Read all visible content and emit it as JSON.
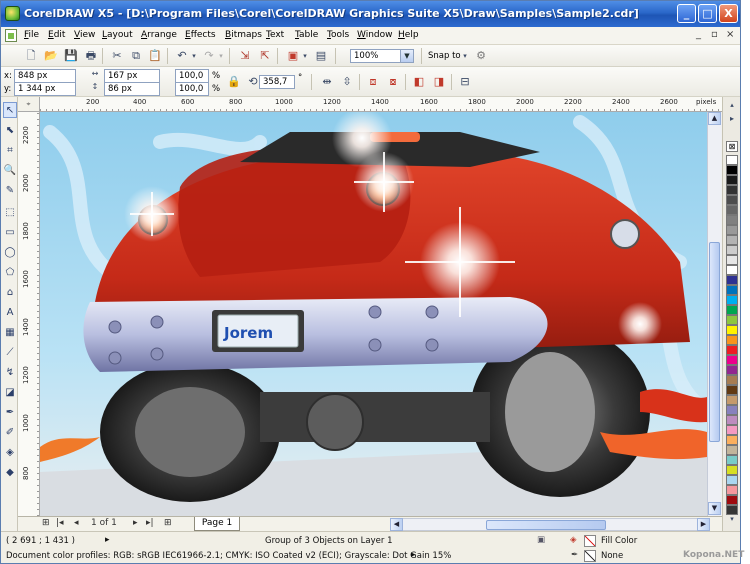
{
  "window": {
    "title": "CorelDRAW X5 - [D:\\Program Files\\Corel\\CorelDRAW Graphics Suite X5\\Draw\\Samples\\Sample2.cdr]",
    "minimize_glyph": "_",
    "maximize_glyph": "□",
    "close_glyph": "X"
  },
  "menubar": {
    "items": [
      "File",
      "Edit",
      "View",
      "Layout",
      "Arrange",
      "Effects",
      "Bitmaps",
      "Text",
      "Table",
      "Tools",
      "Window",
      "Help"
    ],
    "doc_controls": [
      "_",
      "▫",
      "×"
    ]
  },
  "standard_toolbar": {
    "zoom_value": "100%",
    "snap_label": "Snap to"
  },
  "property_bar": {
    "x_label": "x:",
    "x_value": "848 px",
    "y_label": "y:",
    "y_value": "1 344 px",
    "width_value": "167 px",
    "height_value": "86 px",
    "scale_x": "100,0",
    "scale_y": "100,0",
    "percent": "%",
    "rotation_value": "358,7",
    "degree": "°"
  },
  "rulers": {
    "corner": "⌖",
    "top_ticks": [
      "200",
      "400",
      "600",
      "800",
      "1000",
      "1200",
      "1400",
      "1600",
      "1800",
      "2000",
      "2200",
      "2400",
      "2600",
      "pixels"
    ],
    "left_ticks": [
      "2200",
      "2000",
      "1800",
      "1600",
      "1400",
      "1200",
      "1000",
      "800"
    ]
  },
  "document_nav": {
    "page_count": "1 of 1",
    "page_tab": "Page 1"
  },
  "status": {
    "coords": "( 2 691 ; 1 431 )",
    "selection": "Group of 3 Objects on Layer 1",
    "fill_label": "Fill Color",
    "outline_label": "None",
    "color_profiles": "Document color profiles: RGB: sRGB IEC61966-2.1; CMYK: ISO Coated v2 (ECI); Grayscale: Dot Gain 15%"
  },
  "artwork": {
    "license_plate_text": "Jorem"
  },
  "palette_colors": [
    "#ffffff",
    "#000000",
    "#1a1a1a",
    "#333333",
    "#4d4d4d",
    "#666666",
    "#808080",
    "#999999",
    "#b3b3b3",
    "#cccccc",
    "#e6e6e6",
    "#ffffff",
    "#2e3192",
    "#0072bc",
    "#00aeef",
    "#00a651",
    "#8dc63f",
    "#fff200",
    "#f7941d",
    "#ed1c24",
    "#ec008c",
    "#92278f",
    "#a67c52",
    "#603913",
    "#c49a6c",
    "#8781bd",
    "#bd8cbf",
    "#f49ac1",
    "#fbaf5d",
    "#c2b59b",
    "#7accc8",
    "#d7df23",
    "#abd7f0",
    "#f6989d",
    "#9e0b0f",
    "#363636"
  ],
  "watermark": "Kopona.NET"
}
